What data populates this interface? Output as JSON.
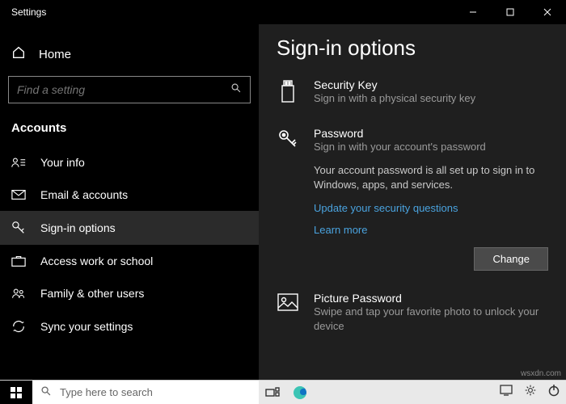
{
  "window": {
    "title": "Settings"
  },
  "sidebar": {
    "home": "Home",
    "search_placeholder": "Find a setting",
    "category": "Accounts",
    "items": [
      {
        "label": "Your info"
      },
      {
        "label": "Email & accounts"
      },
      {
        "label": "Sign-in options"
      },
      {
        "label": "Access work or school"
      },
      {
        "label": "Family & other users"
      },
      {
        "label": "Sync your settings"
      }
    ]
  },
  "content": {
    "heading": "Sign-in options",
    "security_key": {
      "name": "Security Key",
      "desc": "Sign in with a physical security key"
    },
    "password": {
      "name": "Password",
      "desc": "Sign in with your account's password",
      "body": "Your account password is all set up to sign in to Windows, apps, and services.",
      "link_questions": "Update your security questions",
      "link_learn": "Learn more",
      "button": "Change"
    },
    "picture": {
      "name": "Picture Password",
      "desc": "Swipe and tap your favorite photo to unlock your device"
    }
  },
  "taskbar": {
    "search_placeholder": "Type here to search"
  },
  "watermark": "wsxdn.com"
}
